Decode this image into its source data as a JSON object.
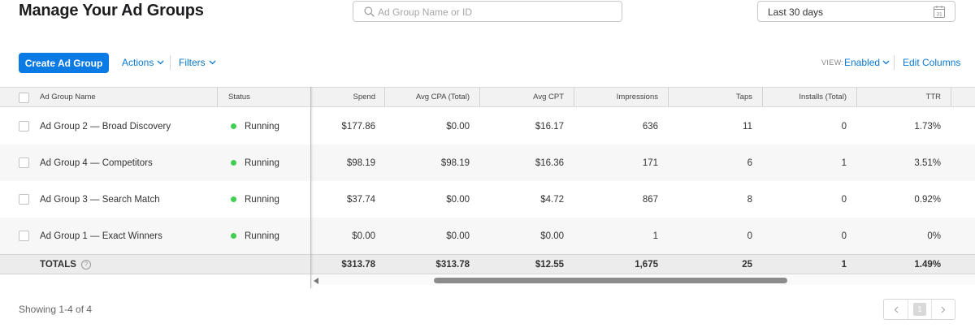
{
  "header": {
    "title": "Manage Your Ad Groups",
    "search_placeholder": "Ad Group Name or ID",
    "date_range": "Last 30 days",
    "calendar_day": "31"
  },
  "toolbar": {
    "create_label": "Create Ad Group",
    "actions_label": "Actions",
    "filters_label": "Filters",
    "view_label": "VIEW:",
    "view_value": "Enabled",
    "edit_columns_label": "Edit Columns"
  },
  "table": {
    "columns": {
      "name": "Ad Group Name",
      "status": "Status",
      "spend": "Spend",
      "avg_cpa": "Avg CPA (Total)",
      "avg_cpt": "Avg CPT",
      "impressions": "Impressions",
      "taps": "Taps",
      "installs": "Installs (Total)",
      "ttr": "TTR"
    },
    "rows": [
      {
        "name": "Ad Group 2 — Broad Discovery",
        "status": "Running",
        "spend": "$177.86",
        "avg_cpa": "$0.00",
        "avg_cpt": "$16.17",
        "impressions": "636",
        "taps": "11",
        "installs": "0",
        "ttr": "1.73%"
      },
      {
        "name": "Ad Group 4 — Competitors",
        "status": "Running",
        "spend": "$98.19",
        "avg_cpa": "$98.19",
        "avg_cpt": "$16.36",
        "impressions": "171",
        "taps": "6",
        "installs": "1",
        "ttr": "3.51%"
      },
      {
        "name": "Ad Group 3 — Search Match",
        "status": "Running",
        "spend": "$37.74",
        "avg_cpa": "$0.00",
        "avg_cpt": "$4.72",
        "impressions": "867",
        "taps": "8",
        "installs": "0",
        "ttr": "0.92%"
      },
      {
        "name": "Ad Group 1 — Exact Winners",
        "status": "Running",
        "spend": "$0.00",
        "avg_cpa": "$0.00",
        "avg_cpt": "$0.00",
        "impressions": "1",
        "taps": "0",
        "installs": "0",
        "ttr": "0%"
      }
    ],
    "totals": {
      "label": "TOTALS",
      "help": "?",
      "spend": "$313.78",
      "avg_cpa": "$313.78",
      "avg_cpt": "$12.55",
      "impressions": "1,675",
      "taps": "25",
      "installs": "1",
      "ttr": "1.49%"
    },
    "status_color": "#3ecf53"
  },
  "footer": {
    "showing_text": "Showing 1-4 of 4",
    "current_page": "1"
  },
  "colors": {
    "accent": "#0a7ae5",
    "link": "#0b78d0"
  }
}
